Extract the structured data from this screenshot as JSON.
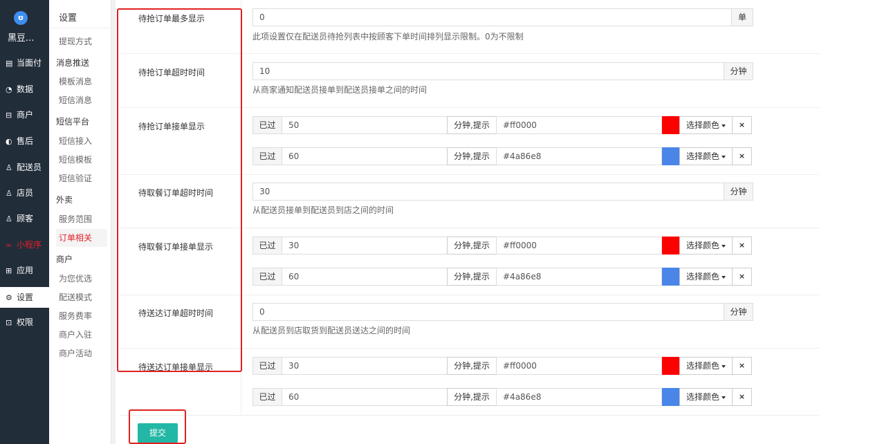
{
  "brand": {
    "logo": "ʊ",
    "name": "黑豆..."
  },
  "nav": [
    "当面付",
    "数据",
    "商户",
    "售后",
    "配送员",
    "店员",
    "顾客",
    "小程序",
    "应用",
    "设置",
    "权限"
  ],
  "sub": {
    "title": "设置",
    "items": [
      "提现方式",
      "消息推送",
      "模板消息",
      "短信消息",
      "短信平台",
      "短信接入",
      "短信模板",
      "短信验证",
      "外卖",
      "服务范围",
      "订单相关",
      "商户",
      "为您优选",
      "配送模式",
      "服务费率",
      "商户入驻",
      "商户活动"
    ]
  },
  "form": {
    "r1": {
      "label": "待抢订单最多显示",
      "value": "0",
      "unit": "单",
      "help": "此项设置仅在配送员待抢列表中按顾客下单时间排列显示限制。0为不限制"
    },
    "r2": {
      "label": "待抢订单超时时间",
      "value": "10",
      "unit": "分钟",
      "help": "从商家通知配送员接单到配送员接单之间的时间"
    },
    "r3": {
      "label": "待抢订单接单显示",
      "a": {
        "pre": "已过",
        "value": "50",
        "mid": "分钟,提示",
        "color_text": "#ff0000",
        "color": "#ff0000",
        "pick": "选择颜色",
        "del": "×"
      },
      "b": {
        "pre": "已过",
        "value": "60",
        "mid": "分钟,提示",
        "color_text": "#4a86e8",
        "color": "#4a86e8",
        "pick": "选择颜色",
        "del": "×"
      }
    },
    "r4": {
      "label": "待取餐订单超时时间",
      "value": "30",
      "unit": "分钟",
      "help": "从配送员接单到配送员到店之间的时间"
    },
    "r5": {
      "label": "待取餐订单接单显示",
      "a": {
        "pre": "已过",
        "value": "30",
        "mid": "分钟,提示",
        "color_text": "#ff0000",
        "color": "#ff0000",
        "pick": "选择颜色",
        "del": "×"
      },
      "b": {
        "pre": "已过",
        "value": "60",
        "mid": "分钟,提示",
        "color_text": "#4a86e8",
        "color": "#4a86e8",
        "pick": "选择颜色",
        "del": "×"
      }
    },
    "r6": {
      "label": "待送达订单超时时间",
      "value": "0",
      "unit": "分钟",
      "help": "从配送员到店取货到配送员送达之间的时间"
    },
    "r7": {
      "label": "待送达订单接单显示",
      "a": {
        "pre": "已过",
        "value": "30",
        "mid": "分钟,提示",
        "color_text": "#ff0000",
        "color": "#ff0000",
        "pick": "选择颜色",
        "del": "×"
      },
      "b": {
        "pre": "已过",
        "value": "60",
        "mid": "分钟,提示",
        "color_text": "#4a86e8",
        "color": "#4a86e8",
        "pick": "选择颜色",
        "del": "×"
      }
    },
    "submit": "提交"
  },
  "colors": {
    "sidebar": "#222d3a",
    "accent_red": "#e2202a",
    "submit": "#23b7a5",
    "annotation": "#e02020"
  }
}
